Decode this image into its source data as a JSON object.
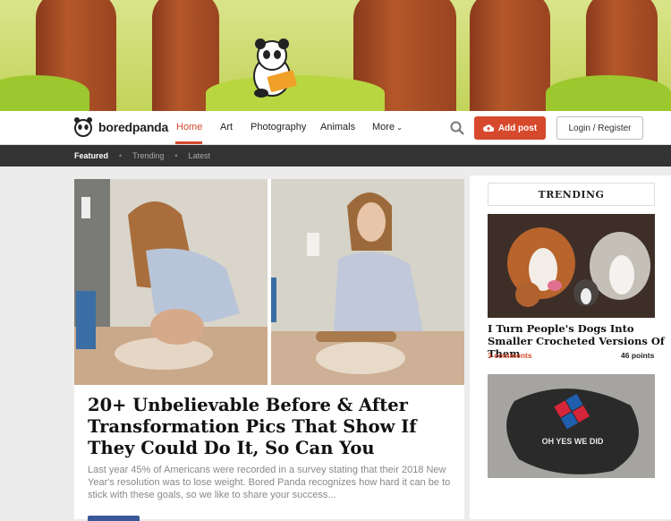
{
  "brand": {
    "name": "boredpanda"
  },
  "nav": {
    "links": [
      "Home",
      "Art",
      "Photography",
      "Animals",
      "More"
    ],
    "add_post": "Add post",
    "login": "Login / Register"
  },
  "subnav": {
    "items": [
      "Featured",
      "Trending",
      "Latest"
    ]
  },
  "article": {
    "title": "20+ Unbelievable Before & After Transformation Pics That Show If They Could Do It, So Can You",
    "excerpt": "Last year 45% of Americans were recorded in a survey stating that their 2018 New Year's resolution was to lose weight. Bored Panda recognizes how hard it can be to stick with these goals, so we like to share your success..."
  },
  "sidebar": {
    "heading": "TRENDING",
    "post1": {
      "title": "I Turn People's Dogs Into Smaller Crocheted Versions Of Them",
      "comments": "3 comments",
      "points": "46 points"
    },
    "post2": {
      "image_text": "OH YES WE DID"
    }
  },
  "colors": {
    "accent": "#d7492c",
    "subnav_bg": "#333333"
  }
}
